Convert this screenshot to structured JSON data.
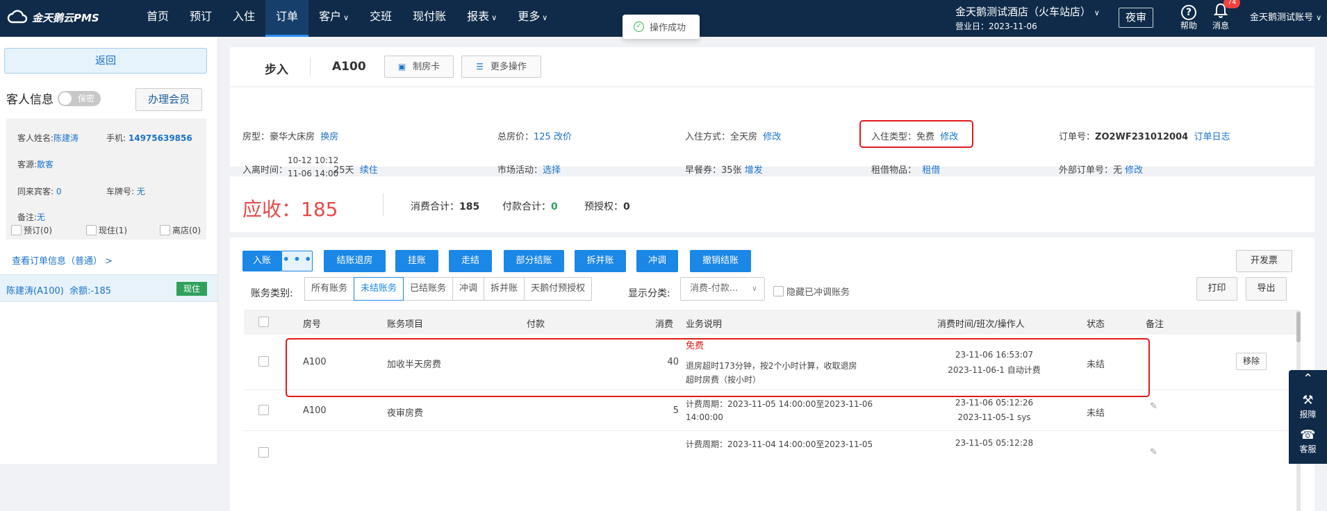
{
  "app": {
    "logo_text": "金天鹅云PMS"
  },
  "nav": {
    "items": [
      {
        "label": "首页",
        "caret": false,
        "active": false
      },
      {
        "label": "预订",
        "caret": false,
        "active": false
      },
      {
        "label": "入住",
        "caret": false,
        "active": false
      },
      {
        "label": "订单",
        "caret": false,
        "active": true
      },
      {
        "label": "客户",
        "caret": true,
        "active": false
      },
      {
        "label": "交班",
        "caret": false,
        "active": false
      },
      {
        "label": "现付账",
        "caret": false,
        "active": false
      },
      {
        "label": "报表",
        "caret": true,
        "active": false
      },
      {
        "label": "更多",
        "caret": true,
        "active": false
      }
    ]
  },
  "toast": {
    "text": "操作成功"
  },
  "topbar": {
    "hotel": "金天鹅测试酒店（火车站店）",
    "business_date": "营业日：2023-11-06",
    "night_audit": "夜审",
    "help_label": "帮助",
    "help_glyph": "?",
    "messages_label": "消息",
    "messages_badge": "74",
    "account": "金天鹅测试账号"
  },
  "sidebar": {
    "back": "返回",
    "guest_info_title": "客人信息",
    "secret_toggle": "保密",
    "member_button": "办理会员",
    "guest_name_label": "客人姓名:",
    "guest_name": "陈建涛",
    "phone_label": "手机:",
    "phone": "14975639856",
    "source_label": "客源:",
    "source": "散客",
    "companions_label": "同来宾客:",
    "companions": "0",
    "plate_label": "车牌号:",
    "plate": "无",
    "remark_label": "备注:",
    "remark": "无",
    "checks": [
      "预订(0)",
      "现住(1)",
      "离店(0)"
    ],
    "view_order": "查看订单信息（普通） >",
    "guest_row_name": "陈建涛(A100)",
    "guest_row_balance": "余额:-185",
    "guest_row_status": "现住"
  },
  "header": {
    "breadcrumb_status": "步入",
    "breadcrumb_room": "A100",
    "make_card": "制房卡",
    "more_ops": "更多操作"
  },
  "details": {
    "room_type_label": "房型：",
    "room_type": "豪华大床房",
    "change_room": "换房",
    "total_price_label": "总房价：",
    "total_price": "125",
    "change_price": "改价",
    "checkin_method_label": "入住方式：",
    "checkin_method": "全天房",
    "edit": "修改",
    "checkin_type_label": "入住类型：",
    "checkin_type": "免费",
    "order_no_label": "订单号：",
    "order_no": "ZO2WF231012004",
    "order_log": "订单日志",
    "stay_time_label": "入离时间：",
    "arrive": "10-12 10:12",
    "depart": "11-06 14:00",
    "nights": "25天",
    "extend": "续住",
    "market_label": "市场活动：",
    "market_select": "选择",
    "breakfast_label": "早餐券：",
    "breakfast": "35张",
    "breakfast_add": "增发",
    "rental_label": "租借物品：",
    "rental": "租借",
    "ext_order_label": "外部订单号：",
    "ext_order": "无",
    "ext_edit": "修改"
  },
  "summary": {
    "receivable_label": "应收：",
    "receivable": "185",
    "consume_label": "消费合计：",
    "consume": "185",
    "payment_label": "付款合计：",
    "payment": "0",
    "preauth_label": "预授权：",
    "preauth": "0"
  },
  "actions": {
    "post": "入账",
    "more_dots": "• • •",
    "buttons": [
      "结账退房",
      "挂账",
      "走结",
      "部分结账",
      "拆并账",
      "冲调",
      "撤销结账"
    ],
    "invoice": "开发票",
    "print": "打印",
    "export": "导出"
  },
  "filters": {
    "category_label": "账务类别:",
    "segments": [
      "所有账务",
      "未结账务",
      "已结账务",
      "冲调",
      "拆并账",
      "天鹅付预授权"
    ],
    "selected": "未结账务",
    "display_label": "显示分类:",
    "display_value": "消费-付款...",
    "hide_reversed": "隐藏已冲调账务"
  },
  "table": {
    "headers": [
      "房号",
      "账务项目",
      "付款",
      "消费",
      "业务说明",
      "消费时间/班次/操作人",
      "状态",
      "备注"
    ],
    "rows": [
      {
        "room": "A100",
        "item": "加收半天房费",
        "payment": "",
        "consume": "40",
        "desc_tag": "免费",
        "desc1": "退房超时173分钟，按2个小时计算，收取退房",
        "desc2": "超时房费（按小时）",
        "time1": "23-11-06 16:53:07",
        "time2": "2023-11-06-1 自动计费",
        "status": "未结",
        "remark": "移除"
      },
      {
        "room": "A100",
        "item": "夜审房费",
        "payment": "",
        "consume": "5",
        "desc_tag": "",
        "desc1": "计费周期：2023-11-05 14:00:00至2023-11-06",
        "desc2": "14:00:00",
        "time1": "23-11-06 05:12:26",
        "time2": "2023-11-05-1 sys",
        "status": "未结",
        "remark": ""
      },
      {
        "room": "",
        "item": "",
        "payment": "",
        "consume": "",
        "desc_tag": "",
        "desc1": "计费周期：2023-11-04 14:00:00至2023-11-05",
        "desc2": "",
        "time1": "23-11-05 05:12:28",
        "time2": "",
        "status": "",
        "remark": ""
      }
    ]
  },
  "floatbar": {
    "report": "报障",
    "service": "客服"
  }
}
